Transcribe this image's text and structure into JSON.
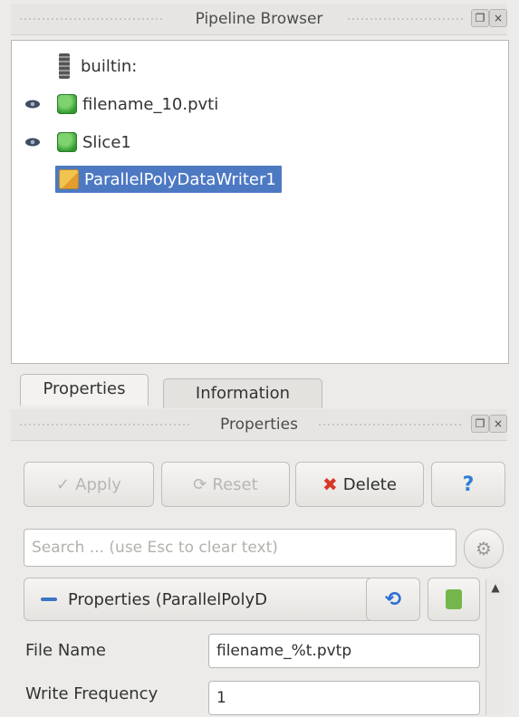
{
  "pipeline_browser": {
    "title": "Pipeline Browser",
    "items": [
      {
        "label": "builtin:"
      },
      {
        "label": "filename_10.pvti"
      },
      {
        "label": "Slice1"
      },
      {
        "label": "ParallelPolyDataWriter1"
      }
    ]
  },
  "tabs": [
    {
      "label": "Properties"
    },
    {
      "label": "Information"
    }
  ],
  "properties_panel": {
    "title": "Properties",
    "buttons": {
      "apply": "Apply",
      "reset": "Reset",
      "delete": "Delete",
      "help": "?"
    },
    "search": {
      "placeholder": "Search ... (use Esc to clear text)"
    },
    "section_header": "Properties (ParallelPolyD",
    "fields": [
      {
        "label": "File Name",
        "value": "filename_%t.pvtp"
      },
      {
        "label": "Write Frequency",
        "value": "1"
      }
    ]
  },
  "colors": {
    "selection": "#4d79c3",
    "delete_icon": "#d8382a",
    "help_icon": "#2f7fd6",
    "reload_icon": "#2c6fd2",
    "adv_icon": "#74b64b"
  }
}
